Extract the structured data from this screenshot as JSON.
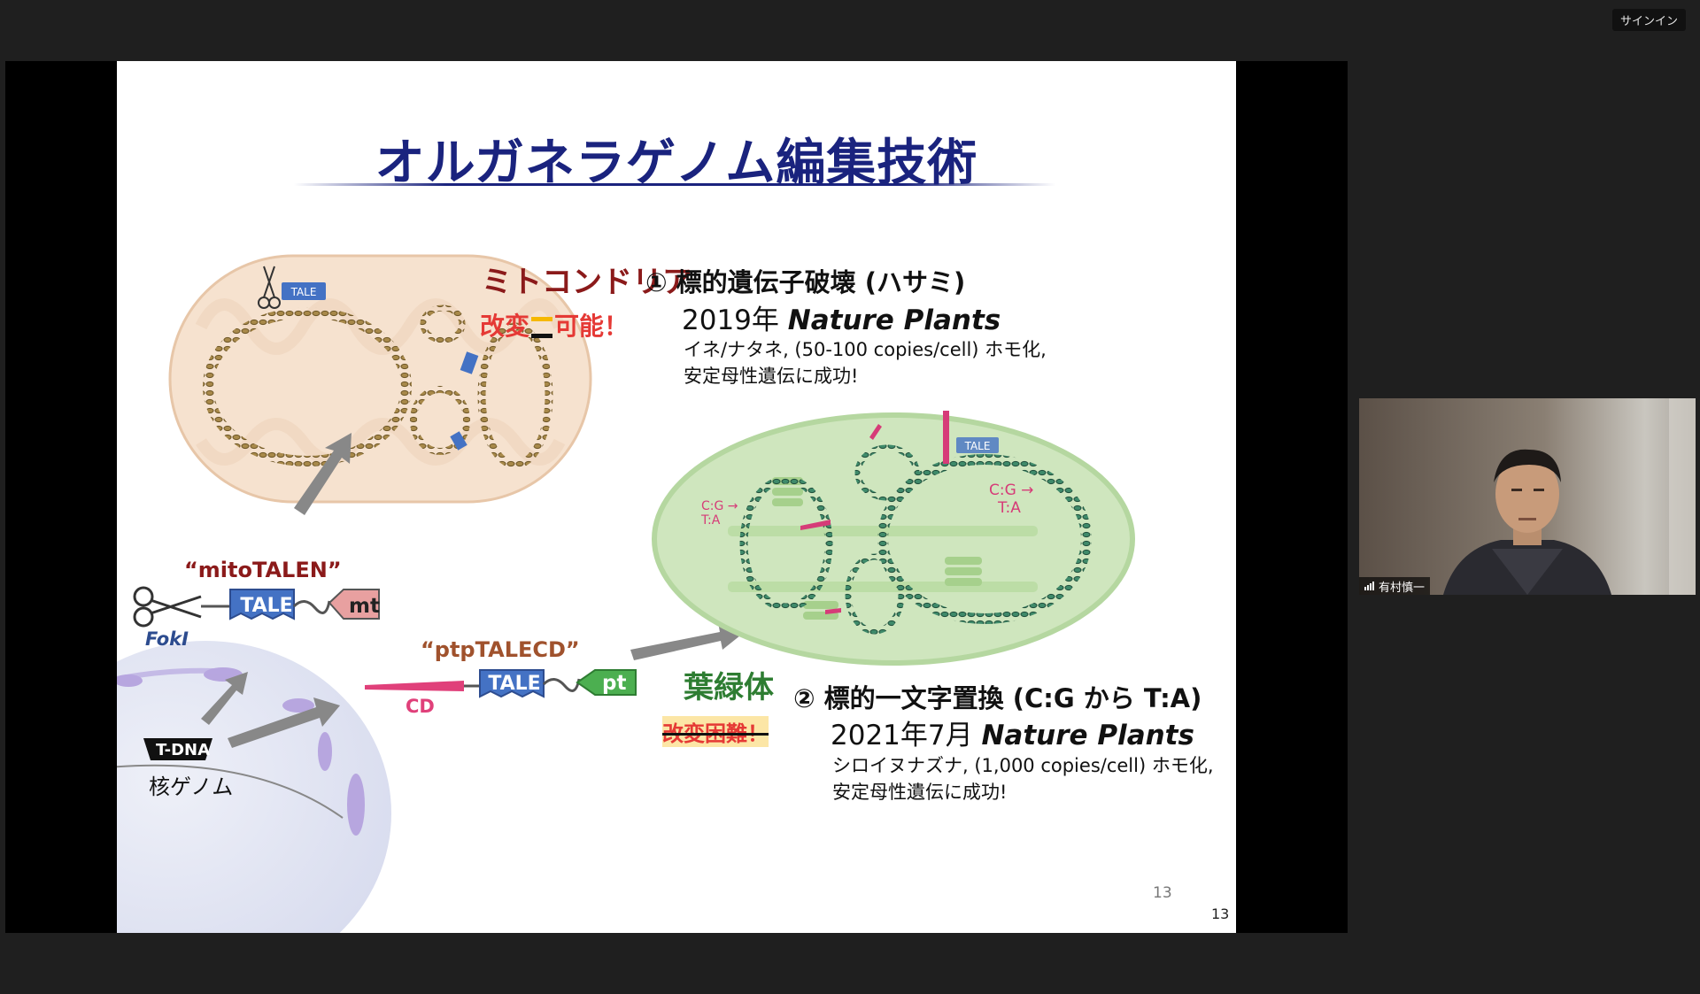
{
  "app": {
    "signin_label": "サインイン"
  },
  "slide": {
    "title": "オルガネラゲノム編集技術",
    "mito_label": "ミトコンドリア",
    "mito_possible_a": "改変",
    "mito_possible_b": "可能！",
    "item1_header": "① 標的遺伝子破壊 (ハサミ)",
    "item1_year": "2019年",
    "item1_journal": "Nature Plants",
    "item1_detail1": "イネ/ナタネ, (50-100 copies/cell) ホモ化,",
    "item1_detail2": "安定母性遺伝に成功!",
    "mitotalen_label": "“mitoTALEN”",
    "fokI_label": "FokI",
    "tale_box_label": "TALE",
    "mt_label": "mt",
    "ptptalecd_label": "“ptpTALECD”",
    "cd_label": "CD",
    "pt_label": "pt",
    "tdna_label": "T-DNA",
    "nuclear_label": "核ゲノム",
    "chloro_label": "葉緑体",
    "chloro_difficult": "改変困難！",
    "item2_header": "② 標的一文字置換 (C:G から T:A)",
    "item2_year": "2021年7月",
    "item2_journal": "Nature Plants",
    "item2_detail1": "シロイヌナズナ, (1,000 copies/cell) ホモ化,",
    "item2_detail2": "安定母性遺伝に成功!",
    "cg_label_a": "C:G →",
    "cg_label_b": "T:A",
    "page_num_small": "13",
    "page_num": "13"
  },
  "participant": {
    "name": "有村慎一"
  },
  "colors": {
    "title": "#1a237e",
    "mito_text": "#8b1a1a",
    "chloro_text": "#2e7d32",
    "red_text": "#e53935",
    "tale_blue": "#4472c4",
    "cd_pink": "#e0407a",
    "pt_green": "#4caf50",
    "mt_pink": "#e8a0a0"
  }
}
